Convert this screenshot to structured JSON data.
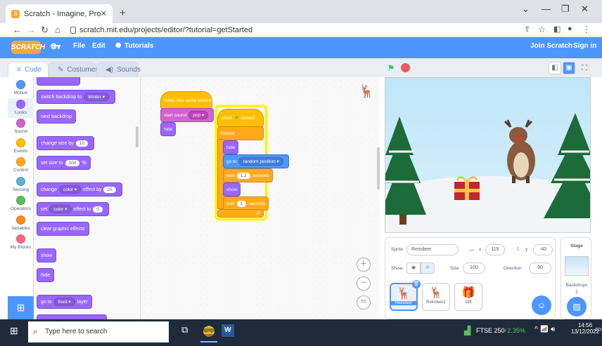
{
  "browser": {
    "tab_title": "Scratch - Imagine, Program, Sha",
    "url": "scratch.mit.edu/projects/editor/?tutorial=getStarted",
    "new_tab": "+"
  },
  "menubar": {
    "logo": "SCRATCH",
    "file": "File",
    "edit": "Edit",
    "tutorials": "Tutorials",
    "join": "Join Scratch",
    "signin": "Sign in"
  },
  "tabs": {
    "code": "Code",
    "costumes": "Costumes",
    "sounds": "Sounds"
  },
  "categories": [
    {
      "label": "Motion",
      "color": "#4c97ff"
    },
    {
      "label": "Looks",
      "color": "#9966ff"
    },
    {
      "label": "Sound",
      "color": "#cf63cf"
    },
    {
      "label": "Events",
      "color": "#ffbf00"
    },
    {
      "label": "Control",
      "color": "#ffab19"
    },
    {
      "label": "Sensing",
      "color": "#5cb1d6"
    },
    {
      "label": "Operators",
      "color": "#59c059"
    },
    {
      "label": "Variables",
      "color": "#ff8c1a"
    },
    {
      "label": "My Blocks",
      "color": "#ff6680"
    }
  ],
  "palette": {
    "switch_backdrop": "switch backdrop to",
    "backdrop_value": "Winter",
    "next_backdrop": "next backdrop",
    "change_size": "change size by",
    "change_size_val": "10",
    "set_size": "set size to",
    "set_size_val": "100",
    "percent": "%",
    "change": "change",
    "effect_color": "color",
    "effect_by": "effect by",
    "effect_by_val": "25",
    "set": "set",
    "effect_to": "effect to",
    "effect_to_val": "0",
    "clear_effects": "clear graphic effects",
    "show": "show",
    "hide": "hide",
    "goto": "go to",
    "front": "front",
    "layer": "layer"
  },
  "script1": {
    "hat": "when this sprite clicked",
    "start_sound": "start sound",
    "sound_val": "pop",
    "hide": "hide"
  },
  "script2": {
    "when": "when",
    "clicked": "clicked",
    "forever": "forever",
    "hide": "hide",
    "goto": "go to",
    "goto_val": "random position",
    "wait": "wait",
    "wait1_val": "1.2",
    "seconds": "seconds",
    "show": "show",
    "wait2_val": "1"
  },
  "sprite_info": {
    "sprite_label": "Sprite",
    "sprite_name": "Reindeer",
    "x_label": "x",
    "x_val": "119",
    "y_label": "y",
    "y_val": "-40",
    "show_label": "Show",
    "size_label": "Size",
    "size_val": "100",
    "direction_label": "Direction",
    "direction_val": "90"
  },
  "sprites": [
    "Reindeer",
    "Reindeer2",
    "Gift"
  ],
  "stage_panel": {
    "title": "Stage",
    "backdrops": "Backdrops",
    "count": "2"
  },
  "taskbar": {
    "search": "Type here to search",
    "stock": "FTSE 250",
    "stock_change": "+2.35%",
    "time": "14:56",
    "date": "13/12/2022"
  }
}
